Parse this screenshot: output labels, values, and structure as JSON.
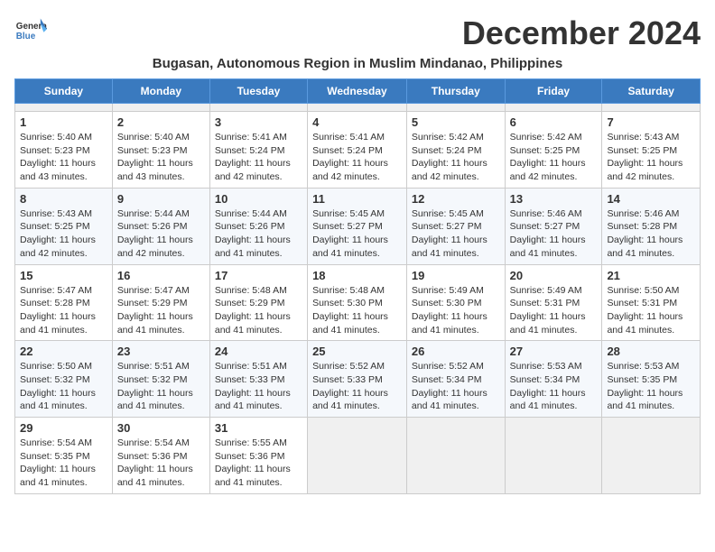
{
  "header": {
    "logo_line1": "General",
    "logo_line2": "Blue",
    "month_title": "December 2024",
    "location": "Bugasan, Autonomous Region in Muslim Mindanao, Philippines"
  },
  "calendar": {
    "days_of_week": [
      "Sunday",
      "Monday",
      "Tuesday",
      "Wednesday",
      "Thursday",
      "Friday",
      "Saturday"
    ],
    "weeks": [
      [
        {
          "day": "",
          "empty": true
        },
        {
          "day": "",
          "empty": true
        },
        {
          "day": "",
          "empty": true
        },
        {
          "day": "",
          "empty": true
        },
        {
          "day": "",
          "empty": true
        },
        {
          "day": "",
          "empty": true
        },
        {
          "day": "",
          "empty": true
        }
      ],
      [
        {
          "day": "1",
          "sunrise": "5:40 AM",
          "sunset": "5:23 PM",
          "daylight": "11 hours and 43 minutes."
        },
        {
          "day": "2",
          "sunrise": "5:40 AM",
          "sunset": "5:23 PM",
          "daylight": "11 hours and 43 minutes."
        },
        {
          "day": "3",
          "sunrise": "5:41 AM",
          "sunset": "5:24 PM",
          "daylight": "11 hours and 42 minutes."
        },
        {
          "day": "4",
          "sunrise": "5:41 AM",
          "sunset": "5:24 PM",
          "daylight": "11 hours and 42 minutes."
        },
        {
          "day": "5",
          "sunrise": "5:42 AM",
          "sunset": "5:24 PM",
          "daylight": "11 hours and 42 minutes."
        },
        {
          "day": "6",
          "sunrise": "5:42 AM",
          "sunset": "5:25 PM",
          "daylight": "11 hours and 42 minutes."
        },
        {
          "day": "7",
          "sunrise": "5:43 AM",
          "sunset": "5:25 PM",
          "daylight": "11 hours and 42 minutes."
        }
      ],
      [
        {
          "day": "8",
          "sunrise": "5:43 AM",
          "sunset": "5:25 PM",
          "daylight": "11 hours and 42 minutes."
        },
        {
          "day": "9",
          "sunrise": "5:44 AM",
          "sunset": "5:26 PM",
          "daylight": "11 hours and 42 minutes."
        },
        {
          "day": "10",
          "sunrise": "5:44 AM",
          "sunset": "5:26 PM",
          "daylight": "11 hours and 41 minutes."
        },
        {
          "day": "11",
          "sunrise": "5:45 AM",
          "sunset": "5:27 PM",
          "daylight": "11 hours and 41 minutes."
        },
        {
          "day": "12",
          "sunrise": "5:45 AM",
          "sunset": "5:27 PM",
          "daylight": "11 hours and 41 minutes."
        },
        {
          "day": "13",
          "sunrise": "5:46 AM",
          "sunset": "5:27 PM",
          "daylight": "11 hours and 41 minutes."
        },
        {
          "day": "14",
          "sunrise": "5:46 AM",
          "sunset": "5:28 PM",
          "daylight": "11 hours and 41 minutes."
        }
      ],
      [
        {
          "day": "15",
          "sunrise": "5:47 AM",
          "sunset": "5:28 PM",
          "daylight": "11 hours and 41 minutes."
        },
        {
          "day": "16",
          "sunrise": "5:47 AM",
          "sunset": "5:29 PM",
          "daylight": "11 hours and 41 minutes."
        },
        {
          "day": "17",
          "sunrise": "5:48 AM",
          "sunset": "5:29 PM",
          "daylight": "11 hours and 41 minutes."
        },
        {
          "day": "18",
          "sunrise": "5:48 AM",
          "sunset": "5:30 PM",
          "daylight": "11 hours and 41 minutes."
        },
        {
          "day": "19",
          "sunrise": "5:49 AM",
          "sunset": "5:30 PM",
          "daylight": "11 hours and 41 minutes."
        },
        {
          "day": "20",
          "sunrise": "5:49 AM",
          "sunset": "5:31 PM",
          "daylight": "11 hours and 41 minutes."
        },
        {
          "day": "21",
          "sunrise": "5:50 AM",
          "sunset": "5:31 PM",
          "daylight": "11 hours and 41 minutes."
        }
      ],
      [
        {
          "day": "22",
          "sunrise": "5:50 AM",
          "sunset": "5:32 PM",
          "daylight": "11 hours and 41 minutes."
        },
        {
          "day": "23",
          "sunrise": "5:51 AM",
          "sunset": "5:32 PM",
          "daylight": "11 hours and 41 minutes."
        },
        {
          "day": "24",
          "sunrise": "5:51 AM",
          "sunset": "5:33 PM",
          "daylight": "11 hours and 41 minutes."
        },
        {
          "day": "25",
          "sunrise": "5:52 AM",
          "sunset": "5:33 PM",
          "daylight": "11 hours and 41 minutes."
        },
        {
          "day": "26",
          "sunrise": "5:52 AM",
          "sunset": "5:34 PM",
          "daylight": "11 hours and 41 minutes."
        },
        {
          "day": "27",
          "sunrise": "5:53 AM",
          "sunset": "5:34 PM",
          "daylight": "11 hours and 41 minutes."
        },
        {
          "day": "28",
          "sunrise": "5:53 AM",
          "sunset": "5:35 PM",
          "daylight": "11 hours and 41 minutes."
        }
      ],
      [
        {
          "day": "29",
          "sunrise": "5:54 AM",
          "sunset": "5:35 PM",
          "daylight": "11 hours and 41 minutes."
        },
        {
          "day": "30",
          "sunrise": "5:54 AM",
          "sunset": "5:36 PM",
          "daylight": "11 hours and 41 minutes."
        },
        {
          "day": "31",
          "sunrise": "5:55 AM",
          "sunset": "5:36 PM",
          "daylight": "11 hours and 41 minutes."
        },
        {
          "day": "",
          "empty": true
        },
        {
          "day": "",
          "empty": true
        },
        {
          "day": "",
          "empty": true
        },
        {
          "day": "",
          "empty": true
        }
      ]
    ]
  }
}
